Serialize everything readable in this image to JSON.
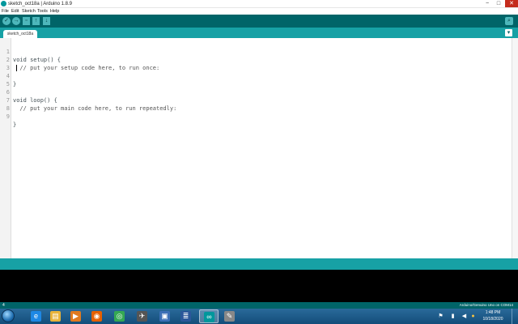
{
  "window": {
    "title": "sketch_oct18a | Arduino 1.8.9",
    "minimize_glyph": "−",
    "maximize_glyph": "□",
    "close_glyph": "✕"
  },
  "menu": [
    "File",
    "Edit",
    "Sketch",
    "Tools",
    "Help"
  ],
  "toolbar": {
    "verify_glyph": "✓",
    "upload_glyph": "→",
    "new_glyph": "▫",
    "open_glyph": "↑",
    "save_glyph": "↓",
    "serial_monitor_glyph": "⌕",
    "accent": "#006468",
    "button_color": "#4db7bb"
  },
  "tabs": [
    {
      "label": "sketch_oct18a"
    }
  ],
  "tab_menu_glyph": "▾",
  "editor": {
    "lines": [
      {
        "num": "1",
        "text": "void setup() {"
      },
      {
        "num": "2",
        "text": "  // put your setup code here, to run once:"
      },
      {
        "num": "3",
        "text": ""
      },
      {
        "num": "4",
        "text": "}"
      },
      {
        "num": "5",
        "text": ""
      },
      {
        "num": "6",
        "text": "void loop() {"
      },
      {
        "num": "7",
        "text": "  // put your main code here, to run repeatedly:"
      },
      {
        "num": "8",
        "text": ""
      },
      {
        "num": "9",
        "text": "}"
      }
    ]
  },
  "status": {
    "line_number": "4",
    "board": "Arduino/Genuino Uno on COM14"
  },
  "taskbar": {
    "apps": [
      {
        "icon": "internet-explorer-icon",
        "glyph": "e",
        "color": "#1e88e5"
      },
      {
        "icon": "file-explorer-icon",
        "glyph": "▤",
        "color": "#e8b33a"
      },
      {
        "icon": "media-player-icon",
        "glyph": "▶",
        "color": "#e07a20"
      },
      {
        "icon": "firefox-icon",
        "glyph": "◉",
        "color": "#e66000"
      },
      {
        "icon": "chrome-icon",
        "glyph": "◎",
        "color": "#34a853"
      },
      {
        "icon": "tool-app-icon",
        "glyph": "✈",
        "color": "#555555"
      },
      {
        "icon": "display-app-icon",
        "glyph": "▣",
        "color": "#3b6fb6"
      },
      {
        "icon": "document-app-icon",
        "glyph": "≣",
        "color": "#2b579a"
      },
      {
        "icon": "arduino-icon",
        "glyph": "∞",
        "color": "#00979c"
      },
      {
        "icon": "paint-app-icon",
        "glyph": "✎",
        "color": "#888888"
      }
    ],
    "tray": {
      "flag_glyph": "⚑",
      "network_glyph": "▮",
      "volume_glyph": "◀",
      "power_glyph": "●"
    },
    "time": "1:48 PM",
    "date": "10/18/2020"
  }
}
